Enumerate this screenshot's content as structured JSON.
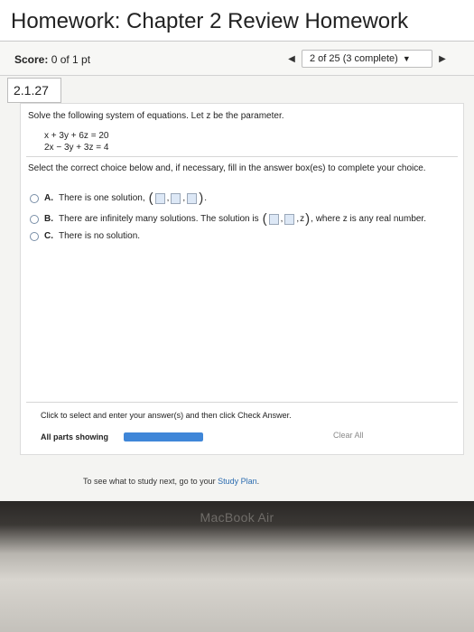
{
  "header": {
    "title": "Homework: Chapter 2 Review Homework"
  },
  "score": {
    "label": "Score:",
    "value": "0 of 1 pt"
  },
  "navigation": {
    "prev_icon": "triangle-left-icon",
    "status": "2 of 25 (3 complete)",
    "dropdown_icon": "triangle-down-icon",
    "next_icon": "triangle-right-icon"
  },
  "question": {
    "number": "2.1.27",
    "prompt": "Solve the following system of equations. Let z be the parameter.",
    "equations": [
      "x + 3y + 6z = 20",
      "2x − 3y + 3z = 4"
    ],
    "instruction": "Select the correct choice below and, if necessary, fill in the answer box(es) to complete your choice."
  },
  "choices": [
    {
      "letter": "A.",
      "text": "There is one solution,",
      "suffix": "."
    },
    {
      "letter": "B.",
      "text": "There are infinitely many solutions. The solution is",
      "z_term": "z",
      "suffix": ", where z is any real number."
    },
    {
      "letter": "C.",
      "text": "There is no solution."
    }
  ],
  "footer": {
    "help": "Click to select and enter your answer(s) and then click Check Answer.",
    "parts_label": "All parts showing",
    "progress": 1.0,
    "clear": "Clear All"
  },
  "study_note": {
    "prefix": "To see what to study next, go to your",
    "link": "Study Plan",
    "suffix": "."
  },
  "device": {
    "brand": "MacBook Air"
  },
  "colors": {
    "accent": "#3f86d8",
    "answer_box": "#dde8f6"
  }
}
